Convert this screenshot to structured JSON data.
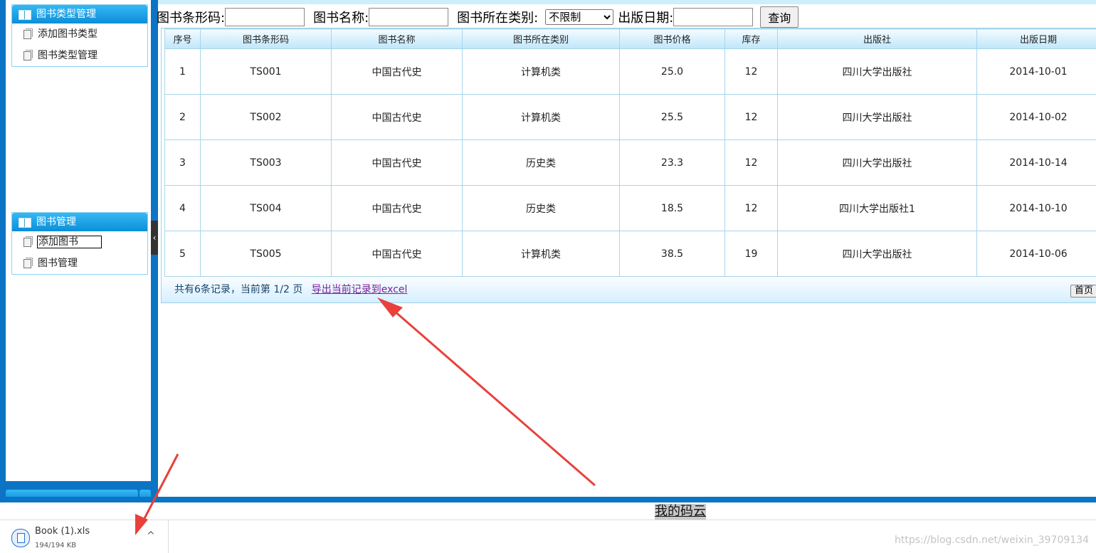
{
  "sidebar": {
    "panels": [
      {
        "title": "图书类型管理",
        "items": [
          "添加图书类型",
          "图书类型管理"
        ]
      },
      {
        "title": "图书管理",
        "items": [
          "添加图书",
          "图书管理"
        ]
      }
    ],
    "collapse_glyph": "‹"
  },
  "search": {
    "barcode_label": "图书条形码:",
    "name_label": "图书名称:",
    "category_label": "图书所在类别:",
    "category_selected": "不限制",
    "date_label": "出版日期:",
    "query_button": "查询"
  },
  "table": {
    "columns": [
      "序号",
      "图书条形码",
      "图书名称",
      "图书所在类别",
      "图书价格",
      "库存",
      "出版社",
      "出版日期"
    ],
    "rows": [
      [
        "1",
        "TS001",
        "中国古代史",
        "计算机类",
        "25.0",
        "12",
        "四川大学出版社",
        "2014-10-01"
      ],
      [
        "2",
        "TS002",
        "中国古代史",
        "计算机类",
        "25.5",
        "12",
        "四川大学出版社",
        "2014-10-02"
      ],
      [
        "3",
        "TS003",
        "中国古代史",
        "历史类",
        "23.3",
        "12",
        "四川大学出版社",
        "2014-10-14"
      ],
      [
        "4",
        "TS004",
        "中国古代史",
        "历史类",
        "18.5",
        "12",
        "四川大学出版社1",
        "2014-10-10"
      ],
      [
        "5",
        "TS005",
        "中国古代史",
        "计算机类",
        "38.5",
        "19",
        "四川大学出版社",
        "2014-10-06"
      ]
    ]
  },
  "pager": {
    "summary": "共有6条记录，当前第 1/2 页",
    "export_link": "导出当前记录到excel",
    "first_button": "首页"
  },
  "footer": {
    "my_code_link": "我的码云"
  },
  "download": {
    "file_name": "Book (1).xls",
    "progress": "194/194 KB",
    "caret": "^"
  },
  "watermark": "https://blog.csdn.net/weixin_39709134",
  "colors": {
    "frame_blue": "#0b74c4",
    "header_blue": "#0a8fd8",
    "arrow_red": "#e8413b",
    "link_purple": "#7a2299"
  }
}
